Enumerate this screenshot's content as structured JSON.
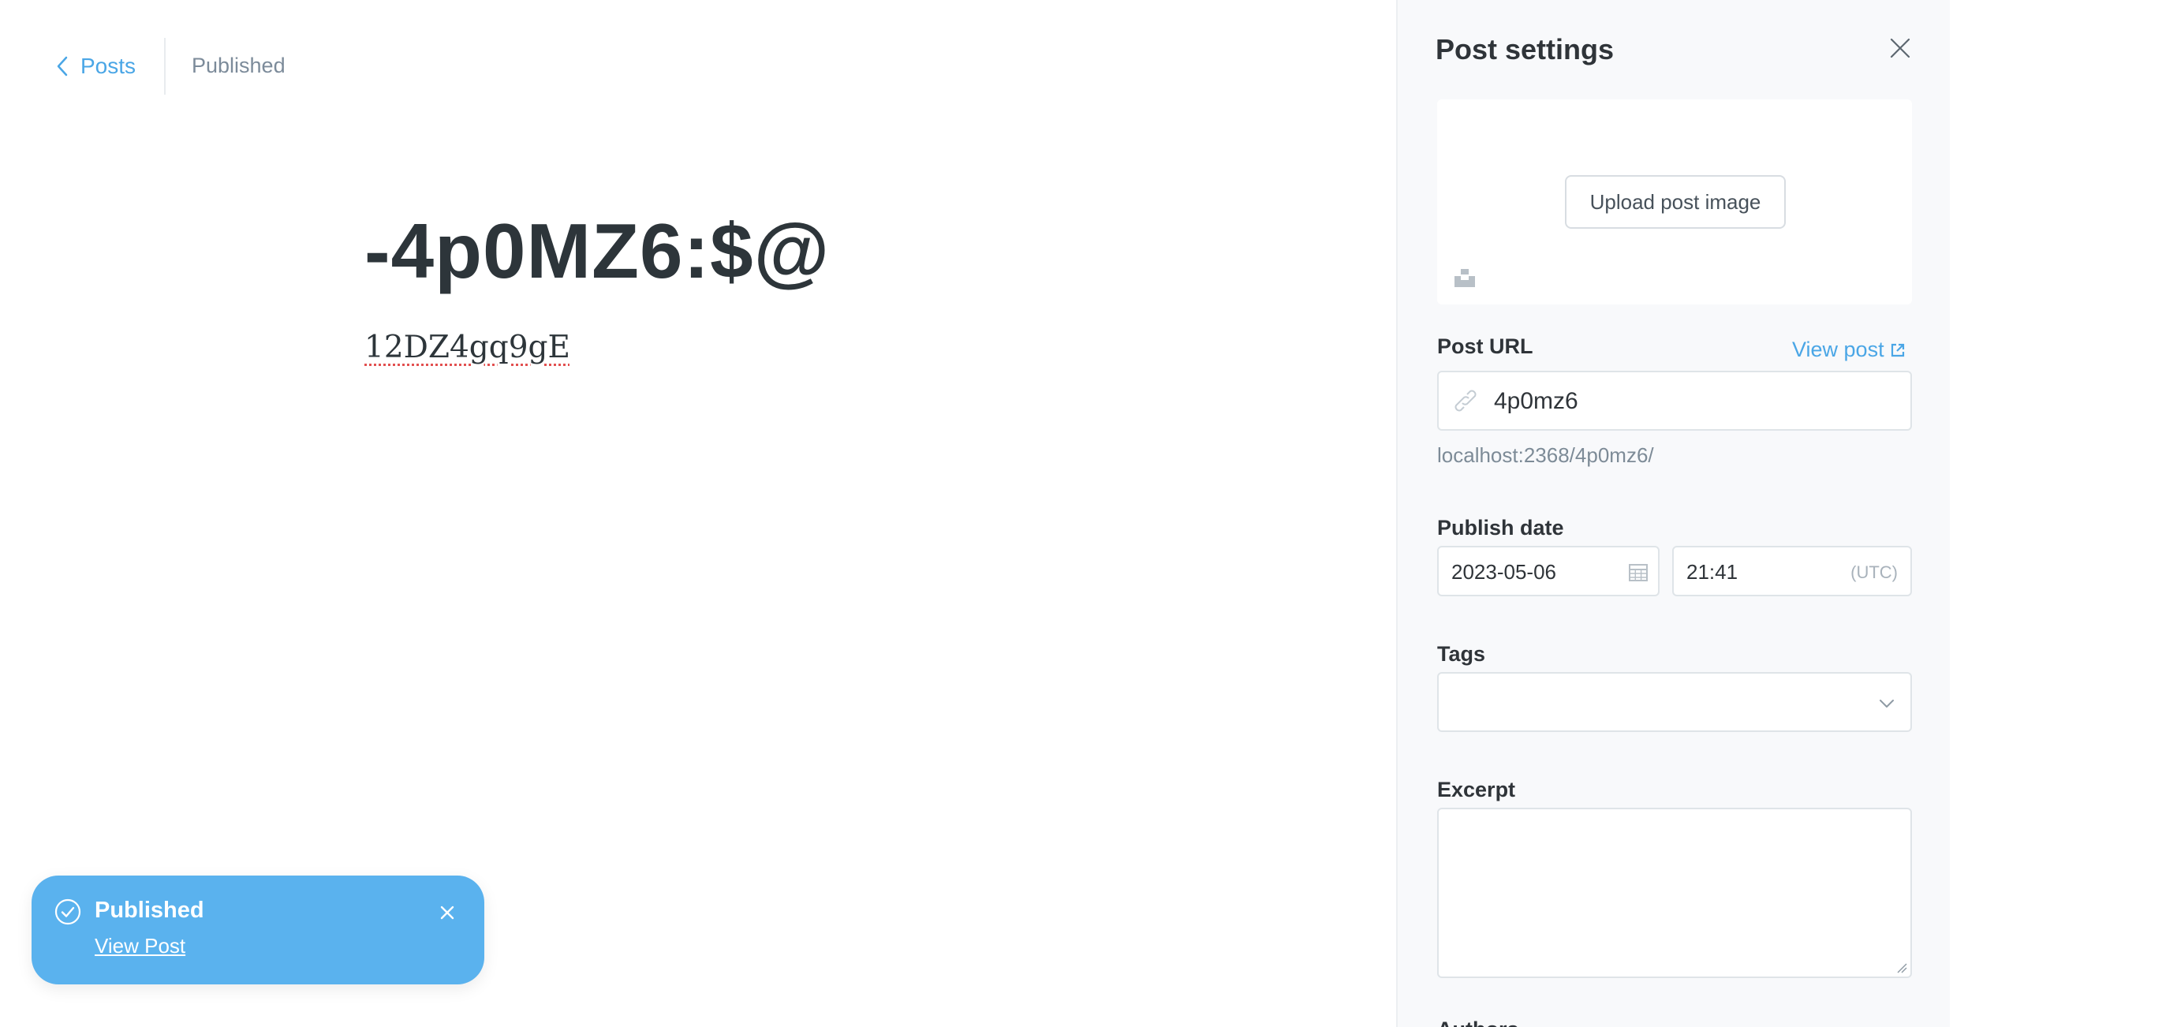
{
  "editor": {
    "back_label": "Posts",
    "status": "Published",
    "title": "-4p0MZ6:$@",
    "body": "12DZ4gq9gE"
  },
  "toast": {
    "title": "Published",
    "link": "View Post"
  },
  "settings": {
    "title": "Post settings",
    "upload_button": "Upload post image",
    "url_label": "Post URL",
    "view_post": "View post",
    "url_value": "4p0mz6",
    "url_hint": "localhost:2368/4p0mz6/",
    "publish_date_label": "Publish date",
    "date_value": "2023-05-06",
    "time_value": "21:41",
    "timezone": "(UTC)",
    "tags_label": "Tags",
    "excerpt_label": "Excerpt",
    "authors_label": "Authors"
  },
  "colors": {
    "accent": "#4aa6e6",
    "toast": "#5ab2ee",
    "panel_bg": "#f8f9fb",
    "title_text": "#2d353a"
  }
}
